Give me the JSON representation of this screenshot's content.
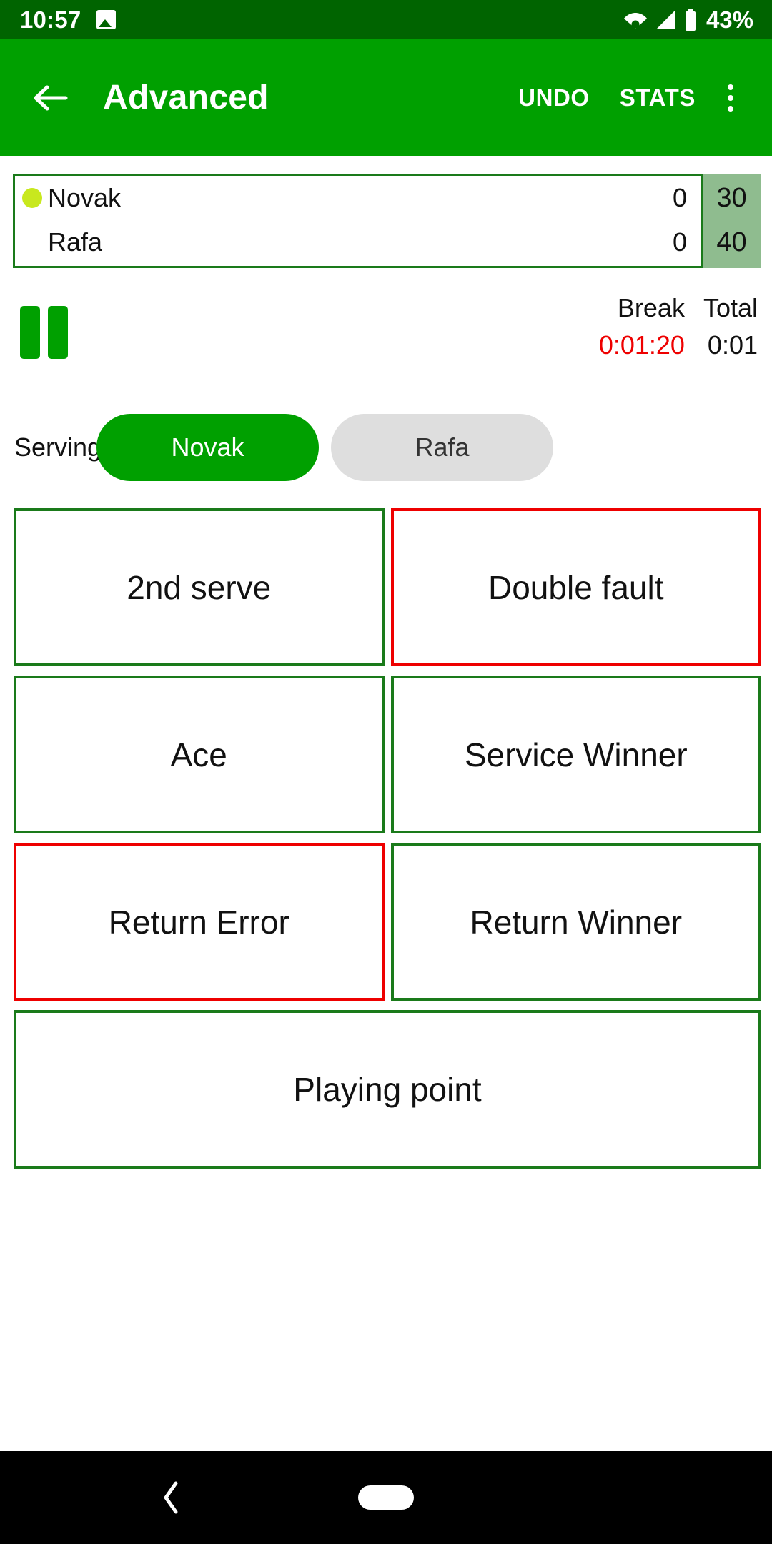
{
  "status_bar": {
    "time": "10:57",
    "image_icon": "image-icon",
    "wifi_icon": "wifi-icon",
    "signal_icon": "cellular-signal-icon",
    "battery_icon": "battery-icon",
    "battery_percent": "43%",
    "background_color": "#006400"
  },
  "app_bar": {
    "back_icon": "back-arrow-icon",
    "title": "Advanced",
    "undo_label": "UNDO",
    "stats_label": "STATS",
    "overflow_icon": "more-vertical-icon",
    "background_color": "#00a000"
  },
  "score_table": {
    "highlight_color": "#8fbc8f",
    "border_color": "#1a7a1a",
    "rows": [
      {
        "serving_indicator": "tennis-ball-icon",
        "name": "Novak",
        "sets": "0",
        "game": "30",
        "is_serving": true
      },
      {
        "serving_indicator": "",
        "name": "Rafa",
        "sets": "0",
        "game": "40",
        "is_serving": false
      }
    ]
  },
  "timers": {
    "pause_icon": "pause-icon",
    "break_label": "Break",
    "total_label": "Total",
    "break_value": "0:01:20",
    "break_color": "#ee0000",
    "total_value": "0:01",
    "total_color": "#111111"
  },
  "serving": {
    "label": "Serving:",
    "options": [
      {
        "name": "Novak",
        "selected": true
      },
      {
        "name": "Rafa",
        "selected": false
      }
    ]
  },
  "actions": {
    "buttons": [
      {
        "label": "2nd serve",
        "accent": "green"
      },
      {
        "label": "Double fault",
        "accent": "red"
      },
      {
        "label": "Ace",
        "accent": "green"
      },
      {
        "label": "Service Winner",
        "accent": "green"
      },
      {
        "label": "Return Error",
        "accent": "red"
      },
      {
        "label": "Return Winner",
        "accent": "green"
      }
    ],
    "wide_button": {
      "label": "Playing point",
      "accent": "green"
    }
  },
  "nav_bar": {
    "back_icon": "nav-back-icon",
    "home_icon": "nav-home-pill-icon",
    "background_color": "#000000"
  }
}
